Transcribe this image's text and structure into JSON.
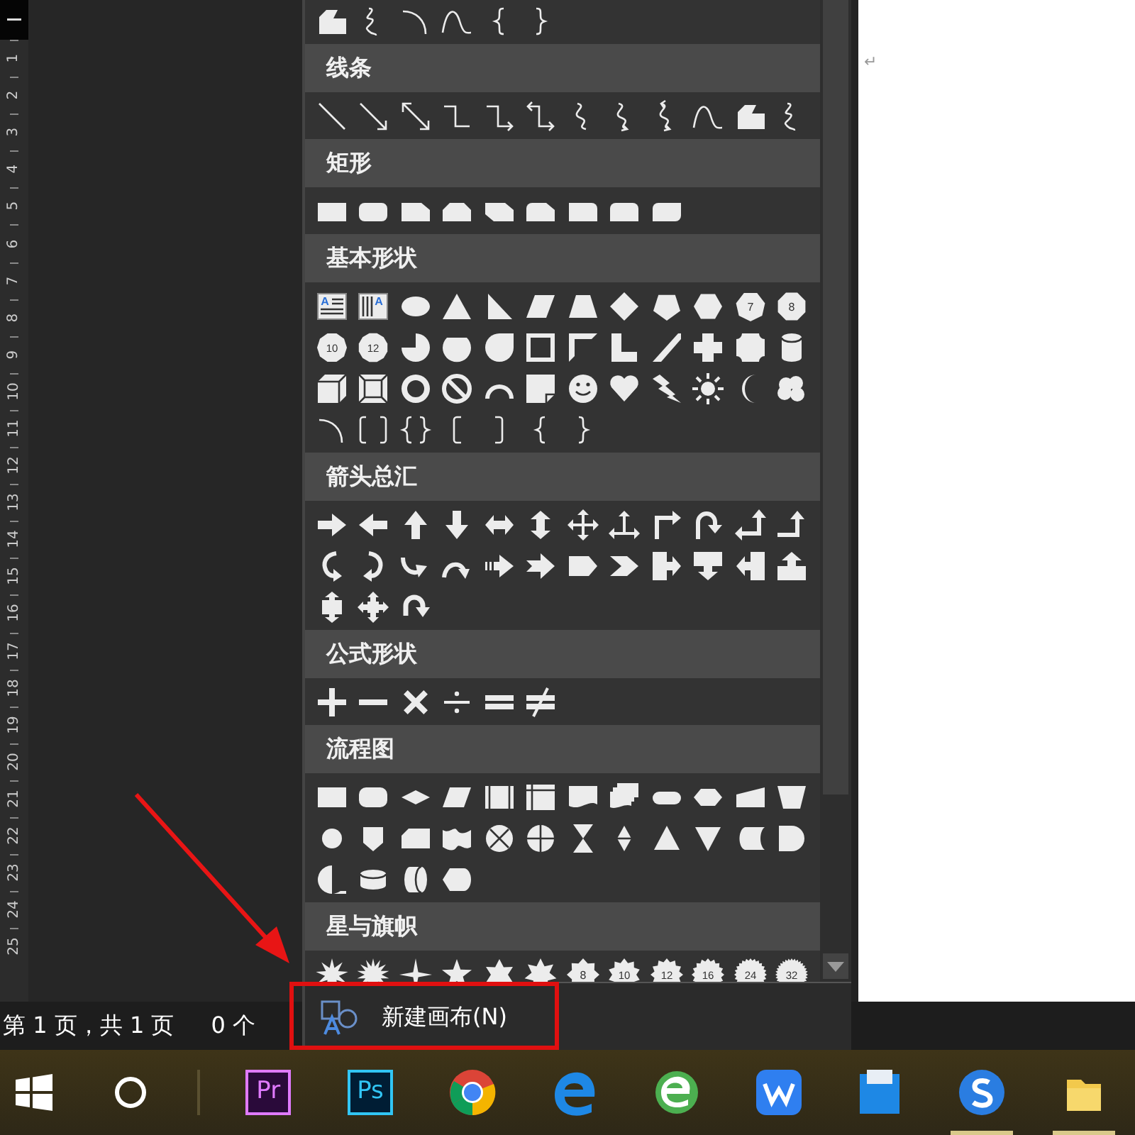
{
  "ruler": {
    "marks": [
      "1",
      "2",
      "3",
      "4",
      "5",
      "6",
      "7",
      "8",
      "9",
      "10",
      "11",
      "12",
      "13",
      "14",
      "15",
      "16",
      "17",
      "18",
      "19",
      "20",
      "21",
      "22",
      "23",
      "24",
      "25"
    ]
  },
  "document": {
    "paragraph_mark": "↵"
  },
  "shape_gallery": {
    "top_row": [
      {
        "kind": "freeform"
      },
      {
        "kind": "scribble"
      },
      {
        "kind": "arc"
      },
      {
        "kind": "curve"
      },
      {
        "kind": "brace-left"
      },
      {
        "kind": "brace-right"
      }
    ],
    "sections": [
      {
        "title": "线条",
        "shapes": [
          {
            "kind": "line"
          },
          {
            "kind": "line-arrow"
          },
          {
            "kind": "line-double-arrow"
          },
          {
            "kind": "elbow"
          },
          {
            "kind": "elbow-arrow"
          },
          {
            "kind": "elbow-double-arrow"
          },
          {
            "kind": "curved"
          },
          {
            "kind": "curved-arrow"
          },
          {
            "kind": "curved-double-arrow"
          },
          {
            "kind": "curve"
          },
          {
            "kind": "freeform"
          },
          {
            "kind": "scribble"
          }
        ]
      },
      {
        "title": "矩形",
        "shapes": [
          {
            "kind": "rect"
          },
          {
            "kind": "round-rect"
          },
          {
            "kind": "snip-corner"
          },
          {
            "kind": "snip-two"
          },
          {
            "kind": "snip-diag"
          },
          {
            "kind": "snip-round"
          },
          {
            "kind": "round-one"
          },
          {
            "kind": "round-two"
          },
          {
            "kind": "round-diag"
          }
        ]
      },
      {
        "title": "基本形状",
        "shapes": [
          {
            "kind": "textbox",
            "label": "A"
          },
          {
            "kind": "vertical-textbox",
            "label": "A"
          },
          {
            "kind": "ellipse"
          },
          {
            "kind": "triangle"
          },
          {
            "kind": "right-triangle"
          },
          {
            "kind": "parallelogram"
          },
          {
            "kind": "trapezoid"
          },
          {
            "kind": "diamond"
          },
          {
            "kind": "pentagon"
          },
          {
            "kind": "hexagon"
          },
          {
            "kind": "heptagon",
            "label": "7"
          },
          {
            "kind": "octagon",
            "label": "8"
          },
          {
            "kind": "decagon",
            "label": "10"
          },
          {
            "kind": "dodecagon",
            "label": "12"
          },
          {
            "kind": "pie"
          },
          {
            "kind": "chord"
          },
          {
            "kind": "teardrop"
          },
          {
            "kind": "frame"
          },
          {
            "kind": "half-frame"
          },
          {
            "kind": "l-shape"
          },
          {
            "kind": "diagonal-stripe"
          },
          {
            "kind": "cross"
          },
          {
            "kind": "plaque"
          },
          {
            "kind": "can"
          },
          {
            "kind": "cube"
          },
          {
            "kind": "bevel"
          },
          {
            "kind": "donut"
          },
          {
            "kind": "no-symbol"
          },
          {
            "kind": "block-arc"
          },
          {
            "kind": "folded-corner"
          },
          {
            "kind": "smiley"
          },
          {
            "kind": "heart"
          },
          {
            "kind": "lightning"
          },
          {
            "kind": "sun"
          },
          {
            "kind": "moon"
          },
          {
            "kind": "cloud"
          },
          {
            "kind": "arc"
          },
          {
            "kind": "bracket-pair"
          },
          {
            "kind": "brace-pair"
          },
          {
            "kind": "bracket-left"
          },
          {
            "kind": "bracket-right"
          },
          {
            "kind": "brace-left"
          },
          {
            "kind": "brace-right"
          }
        ]
      },
      {
        "title": "箭头总汇",
        "shapes": [
          {
            "kind": "arrow-right"
          },
          {
            "kind": "arrow-left"
          },
          {
            "kind": "arrow-up"
          },
          {
            "kind": "arrow-down"
          },
          {
            "kind": "arrow-left-right"
          },
          {
            "kind": "arrow-up-down"
          },
          {
            "kind": "arrow-quad"
          },
          {
            "kind": "arrow-left-right-up"
          },
          {
            "kind": "arrow-bent"
          },
          {
            "kind": "arrow-uturn"
          },
          {
            "kind": "arrow-left-up"
          },
          {
            "kind": "arrow-bent-up"
          },
          {
            "kind": "curved-right-arrow"
          },
          {
            "kind": "curved-left-arrow"
          },
          {
            "kind": "curved-up-arrow"
          },
          {
            "kind": "curved-down-arrow"
          },
          {
            "kind": "striped-right-arrow"
          },
          {
            "kind": "notched-right-arrow"
          },
          {
            "kind": "pentagon-arrow"
          },
          {
            "kind": "chevron"
          },
          {
            "kind": "right-arrow-callout"
          },
          {
            "kind": "down-arrow-callout"
          },
          {
            "kind": "left-arrow-callout"
          },
          {
            "kind": "up-arrow-callout"
          },
          {
            "kind": "up-down-arrow-callout"
          },
          {
            "kind": "quad-arrow-callout"
          },
          {
            "kind": "circular-arrow"
          }
        ]
      },
      {
        "title": "公式形状",
        "shapes": [
          {
            "kind": "plus"
          },
          {
            "kind": "minus"
          },
          {
            "kind": "multiply"
          },
          {
            "kind": "divide"
          },
          {
            "kind": "equal"
          },
          {
            "kind": "not-equal"
          }
        ]
      },
      {
        "title": "流程图",
        "shapes": [
          {
            "kind": "process"
          },
          {
            "kind": "alternate-process"
          },
          {
            "kind": "decision"
          },
          {
            "kind": "data"
          },
          {
            "kind": "predefined-process"
          },
          {
            "kind": "internal-storage"
          },
          {
            "kind": "document"
          },
          {
            "kind": "multidocument"
          },
          {
            "kind": "terminator"
          },
          {
            "kind": "preparation"
          },
          {
            "kind": "manual-input"
          },
          {
            "kind": "manual-operation"
          },
          {
            "kind": "connector"
          },
          {
            "kind": "off-page-connector"
          },
          {
            "kind": "card"
          },
          {
            "kind": "punched-tape"
          },
          {
            "kind": "summing-junction"
          },
          {
            "kind": "or"
          },
          {
            "kind": "collate"
          },
          {
            "kind": "sort"
          },
          {
            "kind": "extract"
          },
          {
            "kind": "merge"
          },
          {
            "kind": "stored-data"
          },
          {
            "kind": "delay"
          },
          {
            "kind": "sequential-storage"
          },
          {
            "kind": "magnetic-disk"
          },
          {
            "kind": "direct-access-storage"
          },
          {
            "kind": "display"
          }
        ]
      },
      {
        "title": "星与旗帜",
        "shapes": [
          {
            "kind": "explosion-one"
          },
          {
            "kind": "explosion-two"
          },
          {
            "kind": "star-4"
          },
          {
            "kind": "star-5"
          },
          {
            "kind": "star-6"
          },
          {
            "kind": "star-7"
          },
          {
            "kind": "star-8",
            "label": "8"
          },
          {
            "kind": "star-10",
            "label": "10"
          },
          {
            "kind": "star-12",
            "label": "12"
          },
          {
            "kind": "star-16",
            "label": "16"
          },
          {
            "kind": "star-24",
            "label": "24"
          },
          {
            "kind": "star-32",
            "label": "32"
          }
        ]
      }
    ],
    "menu_item": {
      "label": "新建画布(N)"
    }
  },
  "status_bar": {
    "page": "第 1 页，共 1 页",
    "words": "0 个"
  },
  "taskbar": [
    {
      "kind": "start",
      "running": false
    },
    {
      "kind": "search",
      "running": false
    },
    {
      "kind": "separator"
    },
    {
      "kind": "premiere",
      "label": "Pr",
      "running": false
    },
    {
      "kind": "photoshop",
      "label": "Ps",
      "running": false
    },
    {
      "kind": "chrome",
      "running": false
    },
    {
      "kind": "edge",
      "running": false
    },
    {
      "kind": "e-browser",
      "running": false
    },
    {
      "kind": "wps",
      "running": false
    },
    {
      "kind": "blue-app",
      "running": false
    },
    {
      "kind": "sogou",
      "running": true
    },
    {
      "kind": "folder",
      "running": true
    }
  ]
}
